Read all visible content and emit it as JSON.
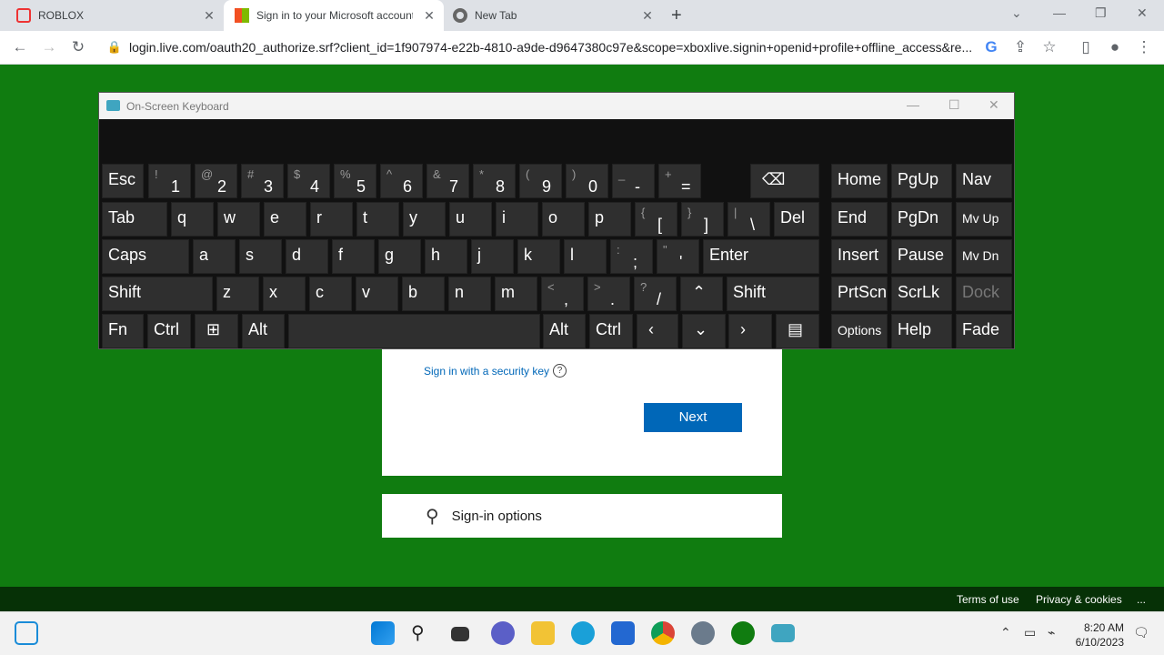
{
  "browser": {
    "tabs": [
      {
        "title": "ROBLOX",
        "active": false,
        "icon": "roblox-icon"
      },
      {
        "title": "Sign in to your Microsoft account",
        "active": true,
        "icon": "microsoft-icon"
      },
      {
        "title": "New Tab",
        "active": false,
        "icon": "chrome-icon"
      }
    ],
    "url": "login.live.com/oauth20_authorize.srf?client_id=1f907974-e22b-4810-a9de-d9647380c97e&scope=xboxlive.signin+openid+profile+offline_access&re..."
  },
  "page": {
    "security_key": "Sign in with a security key",
    "help": "?",
    "next": "Next",
    "signin_options": "Sign-in options",
    "footer_terms": "Terms of use",
    "footer_privacy": "Privacy & cookies",
    "footer_more": "...",
    "bg_color": "#107c10",
    "accent": "#0067b8"
  },
  "osk": {
    "title": "On-Screen Keyboard",
    "row1": [
      "Esc",
      "1",
      "2",
      "3",
      "4",
      "5",
      "6",
      "7",
      "8",
      "9",
      "0",
      "-",
      "="
    ],
    "row1_shift": [
      "~ `",
      "!",
      "@",
      "#",
      "$",
      "%",
      "^",
      "&",
      "*",
      "(",
      ")",
      "_",
      "+"
    ],
    "row2": [
      "Tab",
      "q",
      "w",
      "e",
      "r",
      "t",
      "y",
      "u",
      "i",
      "o",
      "p",
      "[",
      "]",
      "\\",
      "Del"
    ],
    "row2_shift": [
      "{",
      "}",
      "|"
    ],
    "row3": [
      "Caps",
      "a",
      "s",
      "d",
      "f",
      "g",
      "h",
      "j",
      "k",
      "l",
      ";",
      "'",
      "Enter"
    ],
    "row3_shift": [
      ":",
      "\""
    ],
    "row4": [
      "Shift",
      "z",
      "x",
      "c",
      "v",
      "b",
      "n",
      "m",
      ",",
      ".",
      "/",
      "Shift"
    ],
    "row4_shift": [
      "<",
      ">",
      "?"
    ],
    "row5": [
      "Fn",
      "Ctrl",
      "Alt",
      "Alt",
      "Ctrl"
    ],
    "nav": [
      "Home",
      "PgUp",
      "Nav",
      "End",
      "PgDn",
      "Mv Up",
      "Insert",
      "Pause",
      "Mv Dn",
      "PrtScn",
      "ScrLk",
      "Dock",
      "Options",
      "Help",
      "Fade"
    ]
  },
  "taskbar": {
    "time": "8:20 AM",
    "date": "6/10/2023"
  }
}
